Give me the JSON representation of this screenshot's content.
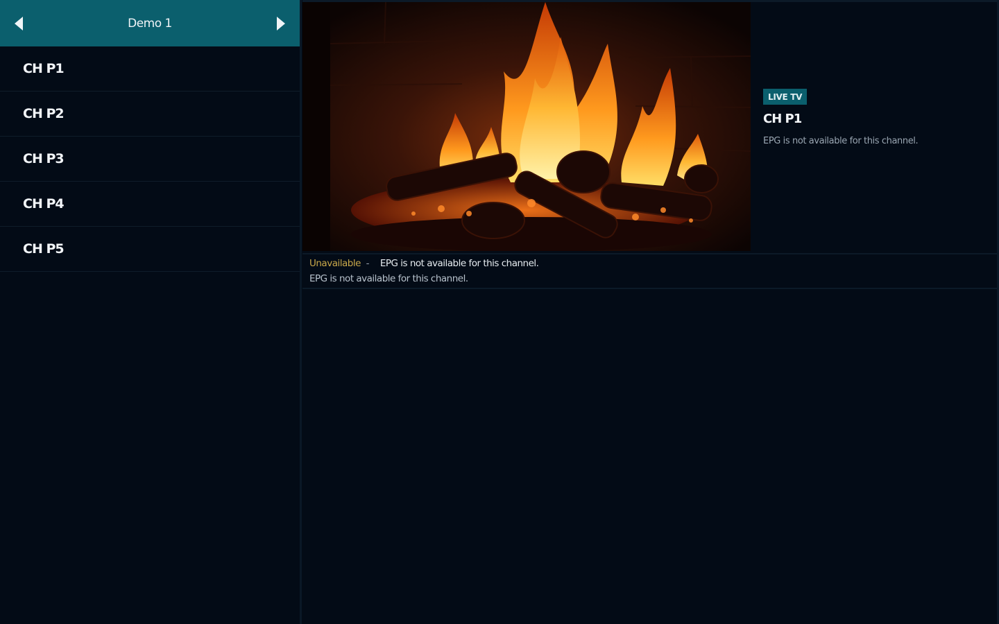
{
  "sidebar": {
    "group_title": "Demo 1",
    "prev_icon": "chevron-left-icon",
    "next_icon": "chevron-right-icon",
    "channels": [
      {
        "label": "CH P1"
      },
      {
        "label": "CH P2"
      },
      {
        "label": "CH P3"
      },
      {
        "label": "CH P4"
      },
      {
        "label": "CH P5"
      }
    ]
  },
  "player": {
    "content": "fireplace-video"
  },
  "info": {
    "badge": "LIVE TV",
    "channel_name": "CH P1",
    "description": "EPG is not available for this channel."
  },
  "epg": {
    "status": "Unavailable",
    "separator": "-",
    "title": "EPG is not available for this channel.",
    "description": "EPG is not available for this channel."
  },
  "colors": {
    "accent": "#0b5f6d",
    "background": "#030b16",
    "status": "#c9a84a"
  }
}
